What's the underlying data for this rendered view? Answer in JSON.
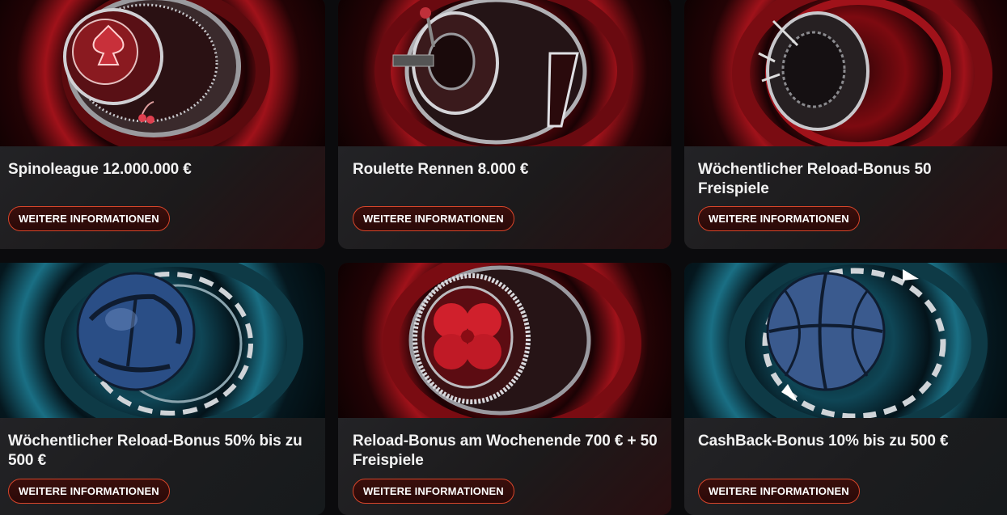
{
  "cards": [
    {
      "title": "Spinoleague 12.000.000 €",
      "button": "WEITERE INFORMATIONEN",
      "theme": "red",
      "image": "slot-reel-spade-icon"
    },
    {
      "title": "Roulette Rennen 8.000 €",
      "button": "WEITERE INFORMATIONEN",
      "theme": "red",
      "image": "slot-machine-lever-icon"
    },
    {
      "title": "Wöchentlicher Reload-Bonus 50 Freispiele",
      "button": "WEITERE INFORMATIONEN",
      "theme": "red",
      "image": "slot-reel-lever-icon"
    },
    {
      "title": "Wöchentlicher Reload-Bonus 50% bis zu 500 €",
      "button": "WEITERE INFORMATIONEN",
      "theme": "teal",
      "image": "soccer-ball-icon"
    },
    {
      "title": "Reload-Bonus am Wochenende 700 € + 50 Freispiele",
      "button": "WEITERE INFORMATIONEN",
      "theme": "red",
      "image": "clover-reel-icon"
    },
    {
      "title": "CashBack-Bonus 10% bis zu 500 €",
      "button": "WEITERE INFORMATIONEN",
      "theme": "teal",
      "image": "basketball-icon"
    }
  ],
  "colors": {
    "accent": "#d8452a",
    "card_bg": "#1e1e21",
    "red_glow": "#a0121a",
    "teal_glow": "#1a6f84"
  }
}
